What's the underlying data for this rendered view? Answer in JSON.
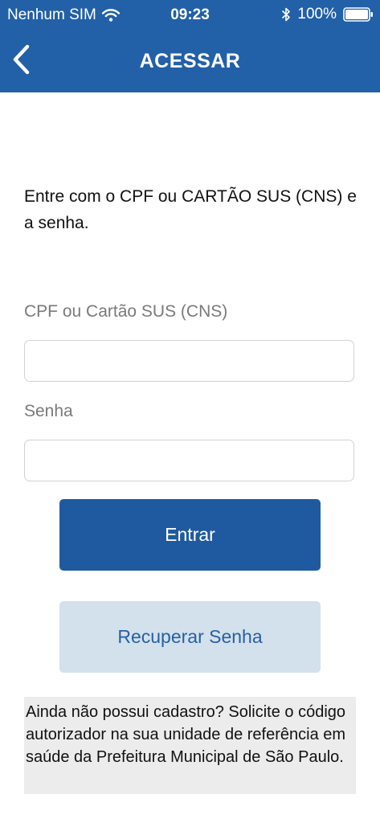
{
  "status_bar": {
    "carrier": "Nenhum SIM",
    "time": "09:23",
    "battery": "100%",
    "icons": [
      "wifi-icon",
      "bluetooth-icon",
      "battery-icon"
    ]
  },
  "nav": {
    "title": "ACESSAR",
    "back_icon": "chevron-left-icon"
  },
  "form": {
    "intro": "Entre com o CPF ou CARTÃO SUS (CNS) e a senha.",
    "cpf_label": "CPF ou Cartão SUS (CNS)",
    "cpf_value": "",
    "senha_label": "Senha",
    "senha_value": ""
  },
  "buttons": {
    "entrar": "Entrar",
    "recuperar": "Recuperar Senha"
  },
  "notice": "Ainda não possui cadastro? Solicite o código autorizador na sua unidade de referência em saúde da Prefeitura Municipal de São Paulo.",
  "colors": {
    "header": "#2260a8",
    "primary_button": "#1f5aa0",
    "secondary_button": "#d3e1ec",
    "secondary_text": "#2760a3",
    "notice_background": "#ececec"
  }
}
